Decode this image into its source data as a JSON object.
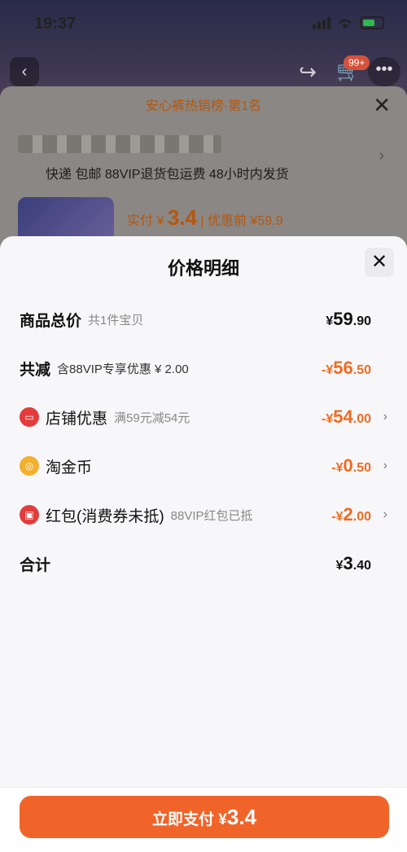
{
  "status": {
    "time": "19:37"
  },
  "background": {
    "cart_badge": "99+",
    "rank_text": "安心裤热销榜·第1名",
    "shipping": "快递 包邮 88VIP退货包运费 48小时内发货",
    "price_prefix": "实付 ¥",
    "price_value": "3.4",
    "price_before": "| 优惠前 ¥59.9"
  },
  "sheet": {
    "title": "价格明细",
    "rows": [
      {
        "label": "商品总价",
        "sub": "共1件宝贝",
        "amount_prefix": "¥",
        "amount_int": "59",
        "amount_dec": ".90"
      },
      {
        "label": "共减",
        "sub": "含88VIP专享优惠 ¥ 2.00",
        "amount_prefix": "-¥",
        "amount_int": "56",
        "amount_dec": ".50"
      },
      {
        "label": "店铺优惠",
        "sub": "满59元减54元",
        "amount_prefix": "-¥",
        "amount_int": "54",
        "amount_dec": ".00"
      },
      {
        "label": "淘金币",
        "sub": "",
        "amount_prefix": "-¥",
        "amount_int": "0",
        "amount_dec": ".50"
      },
      {
        "label": "红包(消费券未抵)",
        "sub": "88VIP红包已抵",
        "amount_prefix": "-¥",
        "amount_int": "2",
        "amount_dec": ".00"
      },
      {
        "label": "合计",
        "sub": "",
        "amount_prefix": "¥",
        "amount_int": "3",
        "amount_dec": ".40"
      }
    ]
  },
  "pay_button": {
    "label": "立即支付",
    "prefix": "¥",
    "amount": "3.4"
  },
  "colors": {
    "accent": "#f0642a",
    "discount": "#ef6b21"
  },
  "icons": [
    "back-icon",
    "share-icon",
    "cart-icon",
    "more-icon",
    "close-icon",
    "shop-discount-icon",
    "gold-coin-icon",
    "red-packet-icon",
    "chevron-right-icon"
  ]
}
